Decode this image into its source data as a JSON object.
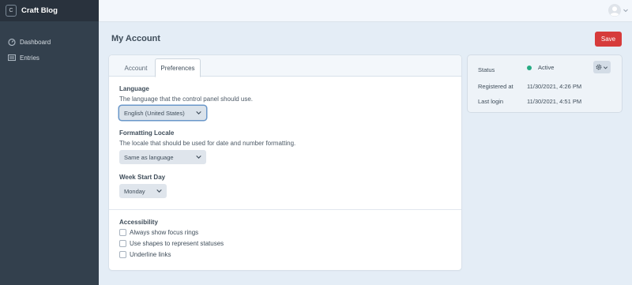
{
  "app": {
    "mark": "C",
    "name": "Craft Blog"
  },
  "nav": [
    {
      "label": "Dashboard",
      "icon": "dashboard-icon"
    },
    {
      "label": "Entries",
      "icon": "entries-icon"
    }
  ],
  "header": {
    "user_icon": "user-avatar-icon"
  },
  "page": {
    "title": "My Account",
    "save_label": "Save"
  },
  "tabs": [
    {
      "label": "Account",
      "active": false
    },
    {
      "label": "Preferences",
      "active": true
    }
  ],
  "preferences": {
    "language": {
      "heading": "Language",
      "description": "The language that the control panel should use.",
      "value": "English (United States)"
    },
    "formatting_locale": {
      "heading": "Formatting Locale",
      "description": "The locale that should be used for date and number formatting.",
      "value": "Same as language"
    },
    "week_start": {
      "heading": "Week Start Day",
      "value": "Monday"
    },
    "accessibility": {
      "heading": "Accessibility",
      "options": [
        {
          "label": "Always show focus rings",
          "checked": false
        },
        {
          "label": "Use shapes to represent statuses",
          "checked": false
        },
        {
          "label": "Underline links",
          "checked": false
        }
      ]
    }
  },
  "meta": {
    "status_label": "Status",
    "status_value": "Active",
    "status_color": "#27ab83",
    "registered_label": "Registered at",
    "registered_value": "11/30/2021, 4:26 PM",
    "last_login_label": "Last login",
    "last_login_value": "11/30/2021, 4:51 PM"
  },
  "colors": {
    "sidebar": "#33404d",
    "accent_red": "#d63b3b",
    "background": "#e4edf6"
  }
}
